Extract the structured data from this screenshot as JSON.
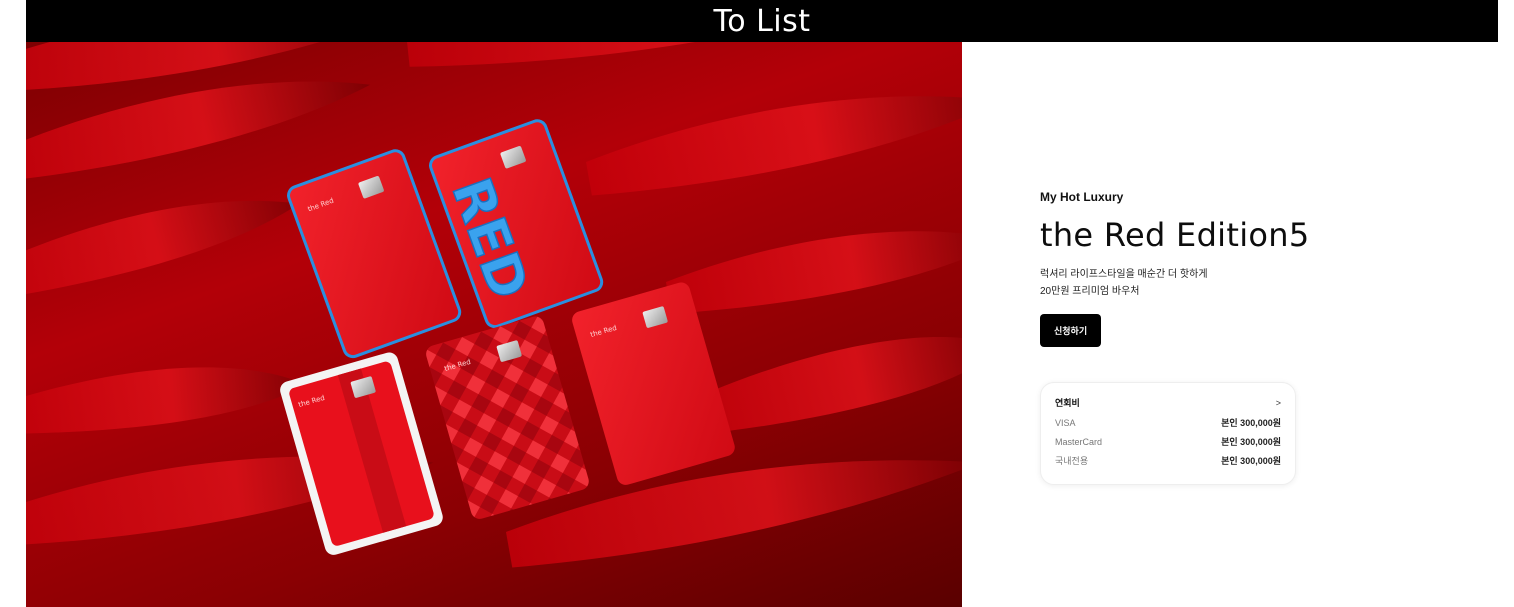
{
  "header": {
    "back_label": "To List"
  },
  "product": {
    "kicker": "My Hot Luxury",
    "title": "the Red Edition5",
    "desc_line1": "럭셔리 라이프스타일을 매순간 더 핫하게",
    "desc_line2": "20만원 프리미엄 바우처",
    "apply_label": "신청하기"
  },
  "annual_fee": {
    "title": "연회비",
    "chevron": ">",
    "rows": [
      {
        "name": "VISA",
        "value": "본인 300,000원"
      },
      {
        "name": "MasterCard",
        "value": "본인 300,000원"
      },
      {
        "name": "국내전용",
        "value": "본인 300,000원"
      }
    ]
  },
  "hero": {
    "card_text": "the Red",
    "card_art_text": "RED",
    "colors": {
      "card_red": "#e8101c",
      "feather_red": "#b30008",
      "accent_blue": "#2a8fe0"
    }
  }
}
